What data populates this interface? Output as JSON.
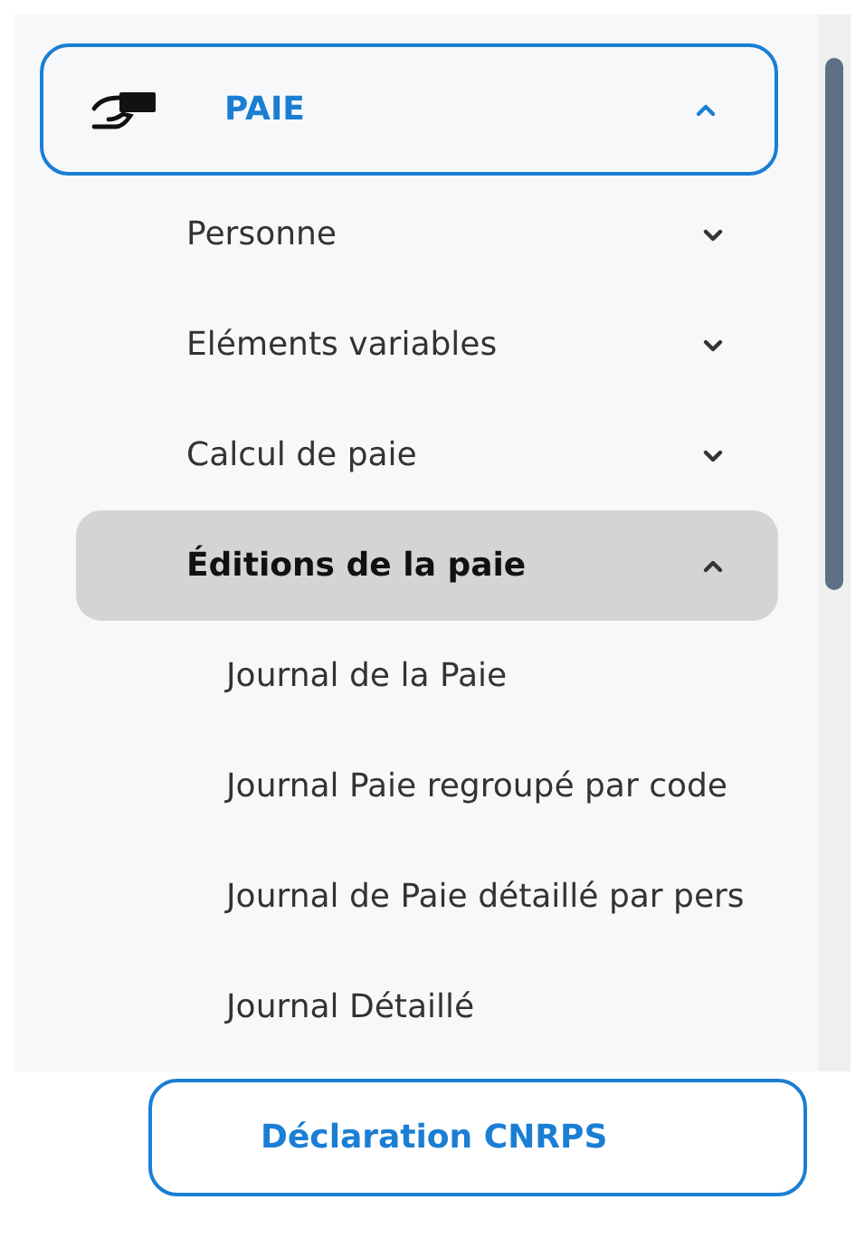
{
  "menu": {
    "label": "PAIE",
    "expanded": true,
    "children": [
      {
        "label": "Personne",
        "expanded": false,
        "selected": false
      },
      {
        "label": "Eléments variables",
        "expanded": false,
        "selected": false
      },
      {
        "label": "Calcul de paie",
        "expanded": false,
        "selected": false
      },
      {
        "label": "Éditions de la paie",
        "expanded": true,
        "selected": true,
        "children": [
          {
            "label": "Journal de la Paie",
            "selected": false
          },
          {
            "label": "Journal Paie regroupé par code",
            "selected": false
          },
          {
            "label": "Journal de Paie détaillé par pers",
            "selected": false
          },
          {
            "label": "Journal Détaillé",
            "selected": false
          },
          {
            "label": "Déclaration CNRPS",
            "selected": true
          }
        ]
      }
    ]
  }
}
